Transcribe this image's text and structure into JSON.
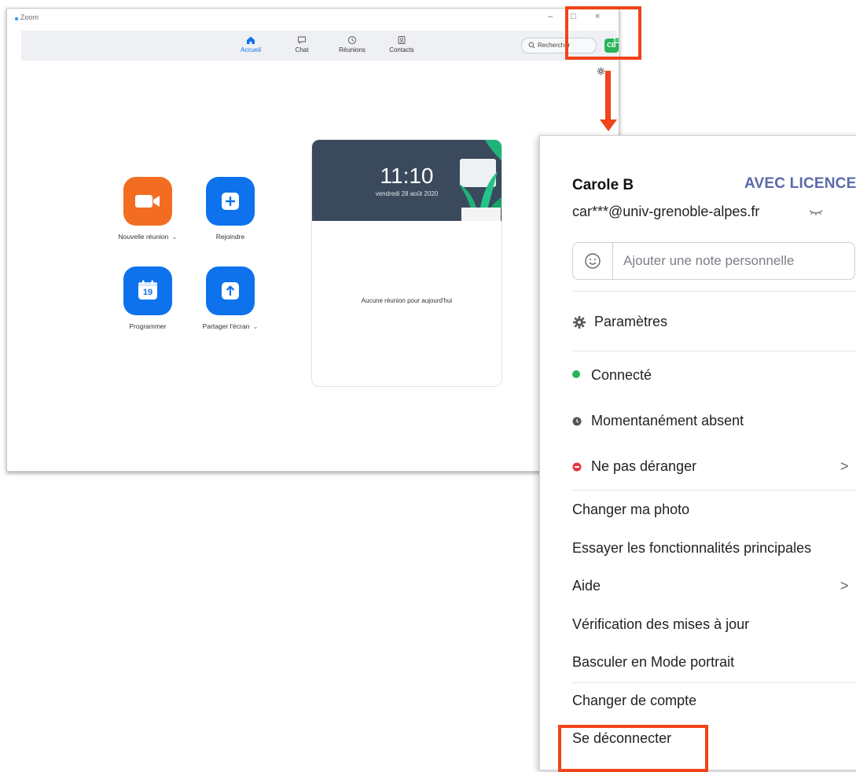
{
  "window": {
    "app_title": "Zoom",
    "minimize": "–",
    "maximize": "□",
    "close": "×"
  },
  "nav": {
    "home": "Accueil",
    "chat": "Chat",
    "meetings": "Réunions",
    "contacts": "Contacts",
    "search": "Rechercher",
    "avatar_initials": "CB"
  },
  "actions": {
    "new_meeting": "Nouvelle réunion",
    "join": "Rejoindre",
    "schedule": "Programmer",
    "schedule_day": "19",
    "share_screen": "Partager l'écran",
    "chevron": "⌄"
  },
  "card": {
    "time": "11:10",
    "date": "vendredi 28 août 2020",
    "empty": "Aucune réunion pour aujourd'hui"
  },
  "menu": {
    "user_name": "Carole B",
    "licence": "AVEC LICENCE",
    "email": "car***@univ-grenoble-alpes.fr",
    "note_placeholder": "Ajouter une note personnelle",
    "settings": "Paramètres",
    "status_connected": "Connecté",
    "status_away": "Momentanément absent",
    "status_dnd": "Ne pas déranger",
    "change_photo": "Changer ma photo",
    "try_features": "Essayer les fonctionnalités principales",
    "help": "Aide",
    "check_updates": "Vérification des mises à jour",
    "portrait_mode": "Basculer en Mode portrait",
    "switch_account": "Changer de compte",
    "sign_out": "Se déconnecter",
    "submenu_chevron": ">"
  },
  "colors": {
    "accent_blue": "#0e72ed",
    "orange": "#f26d21",
    "highlight": "#f0441a",
    "connected": "#28b45a",
    "dnd": "#e8333b"
  }
}
